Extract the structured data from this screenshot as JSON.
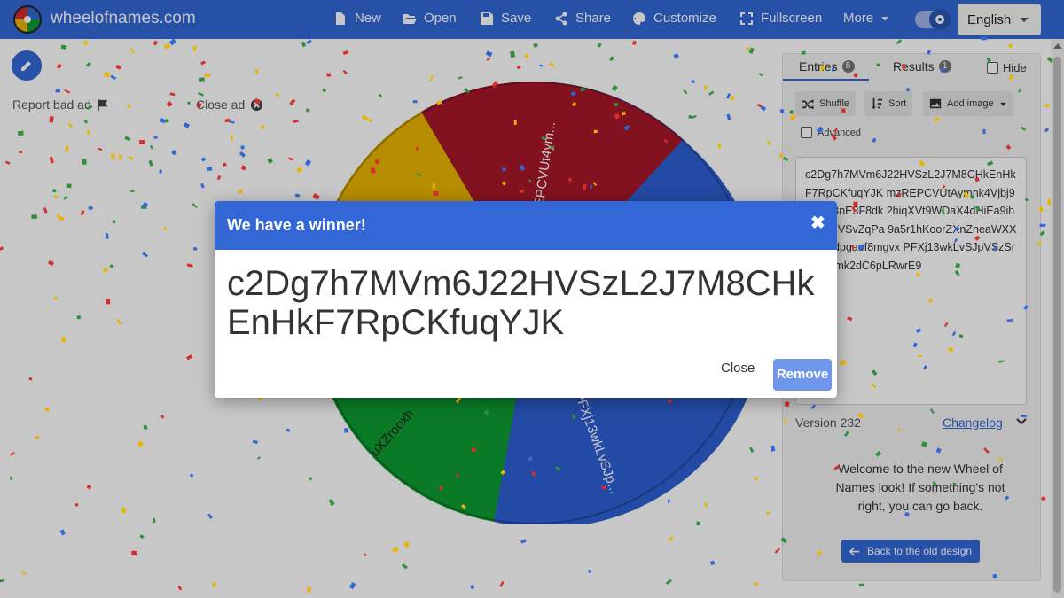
{
  "header": {
    "site_name": "wheelofnames.com",
    "nav": {
      "new": "New",
      "open": "Open",
      "save": "Save",
      "share": "Share",
      "customize": "Customize",
      "fullscreen": "Fullscreen",
      "more": "More"
    },
    "language": "English"
  },
  "ads": {
    "report": "Report bad ad",
    "close": "Close ad"
  },
  "wheel": {
    "labels": [
      "zREPCVUt4ym...",
      "uXZrooxh",
      "PFXj13wkLvSJp..."
    ]
  },
  "panel": {
    "tabs": {
      "entries": "Entries",
      "entries_count": "5",
      "results": "Results",
      "results_count": "1"
    },
    "hide": "Hide",
    "tools": {
      "shuffle": "Shuffle",
      "sort": "Sort",
      "add_image": "Add image"
    },
    "advanced": "Advanced",
    "entries_text": "c2Dg7h7MVm6J22HVSzL2J7M8CHkEnHkF7RpCKfuqYJK\nmzREPCVUtAymnk4Vjbj923jiufBnE3F8dk\n2hiqXVt9WDaX4dHiEa9ihpK3JBVSvZqPa\n9a5r1hKoorZXnZneaWXXYX5Xdpgaof8mgvx\nPFXj13wkLvSJpVSzSrHdDXmk2dC6pLRwrE9",
    "version": "Version 232",
    "changelog": "Changelog",
    "welcome": "Welcome to the new Wheel of Names look! If something's not right, you can go back.",
    "back_button": "Back to the old design"
  },
  "modal": {
    "title": "We have a winner!",
    "winner": "c2Dg7h7MVm6J22HVSzL2J7M8CHkEnHkF7RpCKfuqYJK",
    "close": "Close",
    "remove": "Remove"
  },
  "colors": {
    "brand_blue": "#3367d6",
    "wheel_red": "#a8182a",
    "wheel_yellow": "#e9b400",
    "wheel_green": "#0f9d33",
    "wheel_blue": "#2d5fd2"
  }
}
